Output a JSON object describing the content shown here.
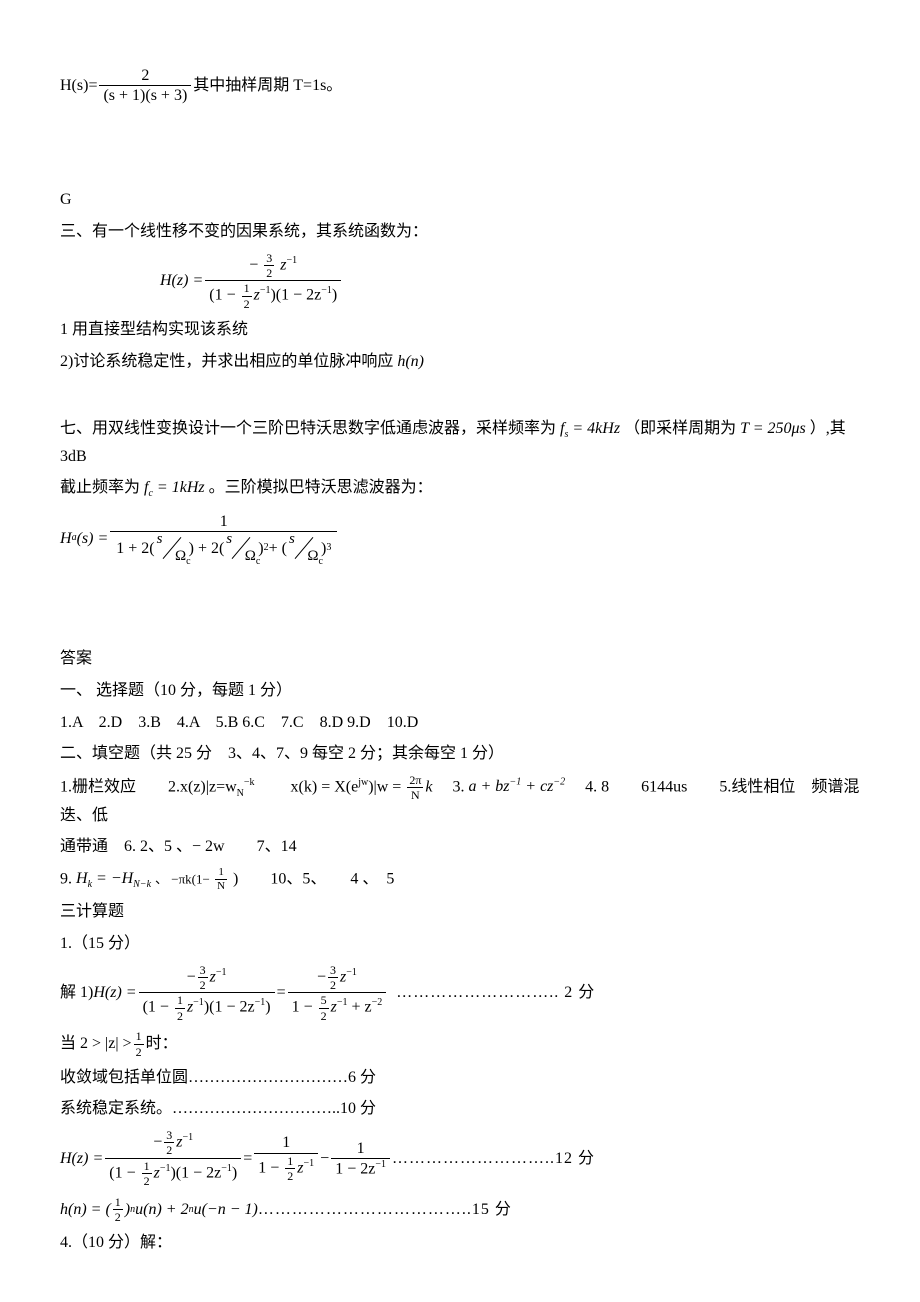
{
  "top_formula": {
    "lhs": "H(s)=",
    "num": "2",
    "den": "(s + 1)(s + 3)",
    "tail": " 其中抽样周期 T=1s。"
  },
  "g_label": "G",
  "q3_intro": "三、有一个线性移不变的因果系统，其系统函数为：",
  "q3_formula": {
    "lhs": "H(z) = ",
    "num_pre": "−",
    "num_frac_num": "3",
    "num_frac_den": "2",
    "num_post": "z",
    "num_sup": "−1",
    "den_a_pre": "(1 − ",
    "den_a_frac_num": "1",
    "den_a_frac_den": "2",
    "den_a_post": "z",
    "den_a_sup": "−1",
    "den_a_close": ")(1 − 2z",
    "den_b_sup": "−1",
    "den_b_close": ")"
  },
  "q3_p1": "1 用直接型结构实现该系统",
  "q3_p2a": "2)讨论系统稳定性，并求出相应的单位脉冲响应",
  "q3_p2b": "h(n)",
  "q7_a": "七、用双线性变换设计一个三阶巴特沃思数字低通虑波器，采样频率为",
  "q7_fs": "f",
  "q7_fs_sub": "s",
  "q7_fs_eq": " = 4kHz",
  "q7_b": "（即采样周期为",
  "q7_T": "T = 250μs",
  "q7_c": "）,其 3dB",
  "q7_d": "截止频率为",
  "q7_fc": "f",
  "q7_fc_sub": "c",
  "q7_fc_eq": " = 1kHz",
  "q7_e": "。三阶模拟巴特沃思滤波器为：",
  "q7_formula": {
    "lhs": "H",
    "lhs_sub": "a",
    "lhs2": "(s) = ",
    "num": "1",
    "den_1": "1 + 2(",
    "den_2": ") + 2(",
    "den_3": ")",
    "den_3_sup": "2",
    "den_4": " + (",
    "den_5": ")",
    "den_5_sup": "3",
    "sf_top": "s",
    "sf_bot": "Ω",
    "sf_bot_sub": "c"
  },
  "ans_header": "答案",
  "ans_mc_title": "一、 选择题（10 分，每题 1 分）",
  "ans_mc": "1.A　2.D　3.B　4.A　5.B 6.C　7.C　8.D 9.D　10.D",
  "ans_fill_title": "二、填空题（共 25 分　3、4、7、9 每空 2 分；其余每空 1 分）",
  "ans_fill1_a": "1.栅栏效应　　2.x(z)|z=w",
  "ans_fill1_a_sub": "N",
  "ans_fill1_a_sup": "−k",
  "ans_fill1_b": "　　x(k) = X(e",
  "ans_fill1_b_sup": "jw",
  "ans_fill1_b2": ")|w = ",
  "ans_fill1_frac_num": "2π",
  "ans_fill1_frac_den": "N",
  "ans_fill1_k": "k",
  "ans_fill1_c": "　3.",
  "ans_fill1_c_expr": "a + bz",
  "ans_fill1_c_sup1": "−1",
  "ans_fill1_c_expr2": " + cz",
  "ans_fill1_c_sup2": "−2",
  "ans_fill1_d": "　4. 8　　6144us　　5.线性相位　频谱混迭、低",
  "ans_fill2": "通带通　6. 2、5 、− 2w　　7、14",
  "ans_fill3a": "9.  ",
  "ans_fill3_hk": "H",
  "ans_fill3_hk_sub": "k",
  "ans_fill3_eq": " = −H",
  "ans_fill3_hk2_sub": "N−k",
  "ans_fill3_b": " 、 −πk(1− ",
  "ans_fill3_frac_num": "1",
  "ans_fill3_frac_den": "N",
  "ans_fill3_c": " )　　10、5、　　4 、　5",
  "calc_title": "三计算题",
  "calc1": "1.（15 分）",
  "calc_s1_lhs": "解 1) ",
  "calc_s1_lhs2": "H(z) = ",
  "calc_s1_mid": " = ",
  "calc_s1_b_num_pre": "−",
  "calc_s1_b_num_frac_num": "3",
  "calc_s1_b_num_frac_den": "2",
  "calc_s1_b_num_post": "z",
  "calc_s1_b_num_sup": "−1",
  "calc_s1_b_den_pre": "1 − ",
  "calc_s1_b_den_frac_num": "5",
  "calc_s1_b_den_frac_den": "2",
  "calc_s1_b_den_mid": "z",
  "calc_s1_b_den_sup1": "−1",
  "calc_s1_b_den_mid2": " + z",
  "calc_s1_b_den_sup2": "−2",
  "calc_s1_dots": "……………………….. 2 分",
  "calc_s2_a": "当 2 > |z| > ",
  "calc_s2_frac_num": "1",
  "calc_s2_frac_den": "2",
  "calc_s2_b": " 时：",
  "calc_s3": "收敛域包括单位圆…………………………6 分",
  "calc_s4": "系统稳定系统。…………………………..10 分",
  "calc_s5_lhs": "H(z) = ",
  "calc_s5_mid": " = ",
  "calc_s5_r1_num": "1",
  "calc_s5_r1_den_pre": "1 − ",
  "calc_s5_r1_den_frac_num": "1",
  "calc_s5_r1_den_frac_den": "2",
  "calc_s5_r1_den_post": "z",
  "calc_s5_r1_den_sup": "−1",
  "calc_s5_minus": " − ",
  "calc_s5_r2_num": "1",
  "calc_s5_r2_den": "1 − 2z",
  "calc_s5_r2_sup": "−1",
  "calc_s5_dots": "………………………..12 分",
  "calc_s6_a": "h(n) = (",
  "calc_s6_frac_num": "1",
  "calc_s6_frac_den": "2",
  "calc_s6_b": ")",
  "calc_s6_sup": "n",
  "calc_s6_c": "u(n) + 2",
  "calc_s6_sup2": "n",
  "calc_s6_d": "u(−n − 1)",
  "calc_s6_dots": " ………………………………..15 分",
  "calc4": "4.（10 分）解："
}
